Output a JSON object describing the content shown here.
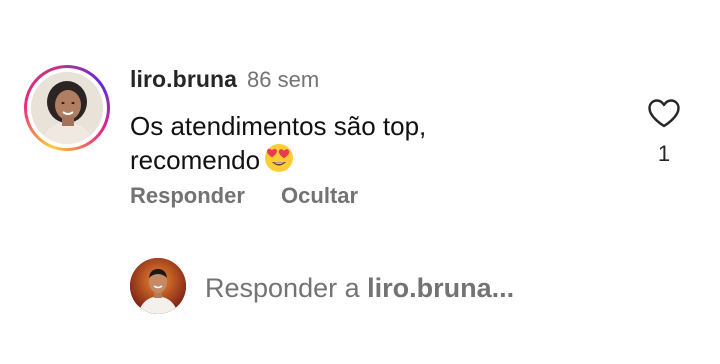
{
  "comment": {
    "username": "liro.bruna",
    "time": "86 sem",
    "text": "Os atendimentos são top,\nrecomendo",
    "emoji": "heart-eyes-emoji",
    "like_count": "1",
    "actions": {
      "reply_label": "Responder",
      "hide_label": "Ocultar"
    }
  },
  "reply": {
    "prefix": "Responder a",
    "target": "liro.bruna..."
  },
  "colors": {
    "text_primary": "#111111",
    "text_secondary": "#737373",
    "ring_gradient": [
      "#f9ce34",
      "#ee2a7b",
      "#6228d7"
    ]
  }
}
